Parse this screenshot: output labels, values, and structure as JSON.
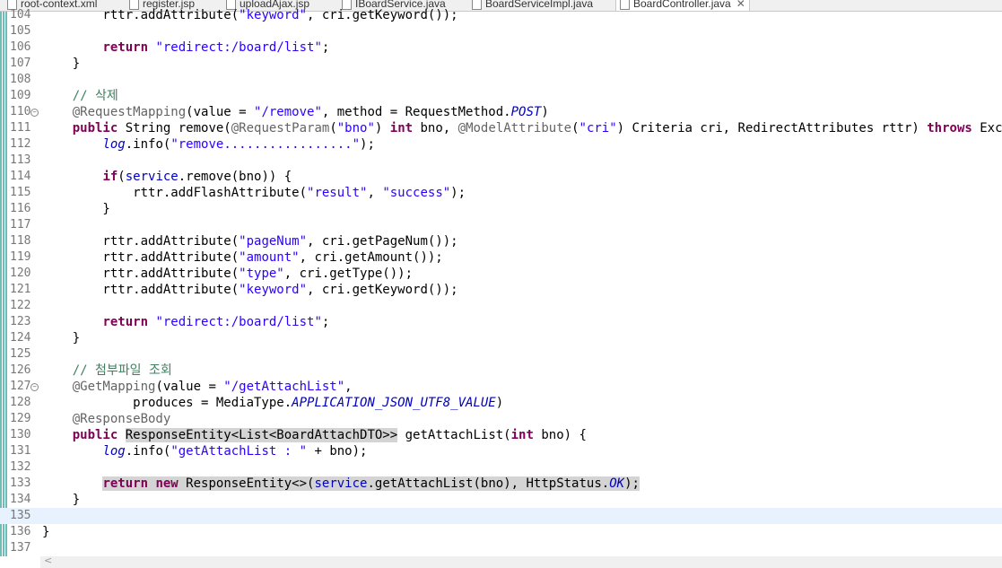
{
  "tabs": [
    {
      "label": "root-context.xml",
      "active": false
    },
    {
      "label": "register.jsp",
      "active": false
    },
    {
      "label": "uploadAjax.jsp",
      "active": false
    },
    {
      "label": "IBoardService.java",
      "active": false
    },
    {
      "label": "BoardServiceImpl.java",
      "active": false
    },
    {
      "label": "BoardController.java",
      "active": true
    }
  ],
  "tab_close_glyph": "✕",
  "scroll_left_glyph": "<",
  "colors": {
    "keyword": "#7f0055",
    "string": "#2a00ff",
    "comment": "#3f7f5f",
    "annotation": "#646464",
    "field": "#0000c0",
    "current_line": "#e8f2fe"
  },
  "editor": {
    "current_line": 135,
    "lines": [
      {
        "n": "104",
        "tokens": [
          [
            "",
            "        rttr.addAttribute("
          ],
          [
            "str",
            "\"keyword\""
          ],
          [
            "",
            ", cri.getKeyword());"
          ]
        ]
      },
      {
        "n": "105",
        "tokens": []
      },
      {
        "n": "106",
        "tokens": [
          [
            "",
            "        "
          ],
          [
            "kw",
            "return"
          ],
          [
            "",
            " "
          ],
          [
            "str",
            "\"redirect:/board/list\""
          ],
          [
            "",
            ";"
          ]
        ]
      },
      {
        "n": "107",
        "tokens": [
          [
            "",
            "    }"
          ]
        ]
      },
      {
        "n": "108",
        "tokens": []
      },
      {
        "n": "109",
        "tokens": [
          [
            "cmt",
            "    // 삭제"
          ]
        ]
      },
      {
        "n": "110",
        "fold": true,
        "tokens": [
          [
            "ann",
            "    @RequestMapping"
          ],
          [
            "",
            "(value = "
          ],
          [
            "str",
            "\"/remove\""
          ],
          [
            "",
            ", method = RequestMethod."
          ],
          [
            "fld ital",
            "POST"
          ],
          [
            "",
            ")"
          ]
        ]
      },
      {
        "n": "111",
        "tokens": [
          [
            "",
            "    "
          ],
          [
            "kw",
            "public"
          ],
          [
            "",
            " String remove("
          ],
          [
            "ann",
            "@RequestParam"
          ],
          [
            "",
            "("
          ],
          [
            "str",
            "\"bno\""
          ],
          [
            "",
            ") "
          ],
          [
            "kw",
            "int"
          ],
          [
            "",
            " bno, "
          ],
          [
            "ann",
            "@ModelAttribute"
          ],
          [
            "",
            "("
          ],
          [
            "str",
            "\"cri\""
          ],
          [
            "",
            ") Criteria cri, RedirectAttributes rttr) "
          ],
          [
            "kw",
            "throws"
          ],
          [
            "",
            " Exception"
          ]
        ]
      },
      {
        "n": "112",
        "tokens": [
          [
            "",
            "        "
          ],
          [
            "fld ital",
            "log"
          ],
          [
            "",
            ".info("
          ],
          [
            "str",
            "\"remove.................\""
          ],
          [
            "",
            ");"
          ]
        ]
      },
      {
        "n": "113",
        "tokens": []
      },
      {
        "n": "114",
        "tokens": [
          [
            "",
            "        "
          ],
          [
            "kw",
            "if"
          ],
          [
            "",
            "("
          ],
          [
            "fld",
            "service"
          ],
          [
            "",
            ".remove(bno)) {"
          ]
        ]
      },
      {
        "n": "115",
        "tokens": [
          [
            "",
            "            rttr.addFlashAttribute("
          ],
          [
            "str",
            "\"result\""
          ],
          [
            "",
            ", "
          ],
          [
            "str",
            "\"success\""
          ],
          [
            "",
            ");"
          ]
        ]
      },
      {
        "n": "116",
        "tokens": [
          [
            "",
            "        }"
          ]
        ]
      },
      {
        "n": "117",
        "tokens": []
      },
      {
        "n": "118",
        "tokens": [
          [
            "",
            "        rttr.addAttribute("
          ],
          [
            "str",
            "\"pageNum\""
          ],
          [
            "",
            ", cri.getPageNum());"
          ]
        ]
      },
      {
        "n": "119",
        "tokens": [
          [
            "",
            "        rttr.addAttribute("
          ],
          [
            "str",
            "\"amount\""
          ],
          [
            "",
            ", cri.getAmount());"
          ]
        ]
      },
      {
        "n": "120",
        "tokens": [
          [
            "",
            "        rttr.addAttribute("
          ],
          [
            "str",
            "\"type\""
          ],
          [
            "",
            ", cri.getType());"
          ]
        ]
      },
      {
        "n": "121",
        "tokens": [
          [
            "",
            "        rttr.addAttribute("
          ],
          [
            "str",
            "\"keyword\""
          ],
          [
            "",
            ", cri.getKeyword());"
          ]
        ]
      },
      {
        "n": "122",
        "tokens": []
      },
      {
        "n": "123",
        "tokens": [
          [
            "",
            "        "
          ],
          [
            "kw",
            "return"
          ],
          [
            "",
            " "
          ],
          [
            "str",
            "\"redirect:/board/list\""
          ],
          [
            "",
            ";"
          ]
        ]
      },
      {
        "n": "124",
        "tokens": [
          [
            "",
            "    }"
          ]
        ]
      },
      {
        "n": "125",
        "tokens": []
      },
      {
        "n": "126",
        "tokens": [
          [
            "cmt",
            "    // 첨부파일 조회"
          ]
        ]
      },
      {
        "n": "127",
        "fold": true,
        "tokens": [
          [
            "ann",
            "    @GetMapping"
          ],
          [
            "",
            "(value = "
          ],
          [
            "str",
            "\"/getAttachList\""
          ],
          [
            "",
            ","
          ]
        ]
      },
      {
        "n": "128",
        "tokens": [
          [
            "",
            "            produces = MediaType."
          ],
          [
            "fld ital",
            "APPLICATION_JSON_UTF8_VALUE"
          ],
          [
            "",
            ")"
          ]
        ]
      },
      {
        "n": "129",
        "tokens": [
          [
            "ann",
            "    @ResponseBody"
          ]
        ]
      },
      {
        "n": "130",
        "tokens": [
          [
            "",
            "    "
          ],
          [
            "kw",
            "public"
          ],
          [
            "",
            " "
          ],
          [
            "hl",
            "ResponseEntity<List<BoardAttachDTO>>"
          ],
          [
            "",
            " getAttachList("
          ],
          [
            "kw",
            "int"
          ],
          [
            "",
            " bno) {"
          ]
        ]
      },
      {
        "n": "131",
        "tokens": [
          [
            "",
            "        "
          ],
          [
            "fld ital",
            "log"
          ],
          [
            "",
            ".info("
          ],
          [
            "str",
            "\"getAttachList : \""
          ],
          [
            "",
            " + bno);"
          ]
        ]
      },
      {
        "n": "132",
        "tokens": []
      },
      {
        "n": "133",
        "tokens": [
          [
            "",
            "        "
          ],
          [
            "kw hl",
            "return"
          ],
          [
            "hl",
            " "
          ],
          [
            "kw hl",
            "new"
          ],
          [
            "hl",
            " ResponseEntity<>("
          ],
          [
            "fld hl",
            "service"
          ],
          [
            "hl",
            ".getAttachList(bno), HttpStatus."
          ],
          [
            "fld ital hl",
            "OK"
          ],
          [
            "hl",
            ");"
          ]
        ]
      },
      {
        "n": "134",
        "tokens": [
          [
            "",
            "    }"
          ]
        ]
      },
      {
        "n": "135",
        "tokens": []
      },
      {
        "n": "136",
        "tokens": [
          [
            "",
            "}"
          ]
        ]
      },
      {
        "n": "137",
        "tokens": []
      }
    ]
  }
}
